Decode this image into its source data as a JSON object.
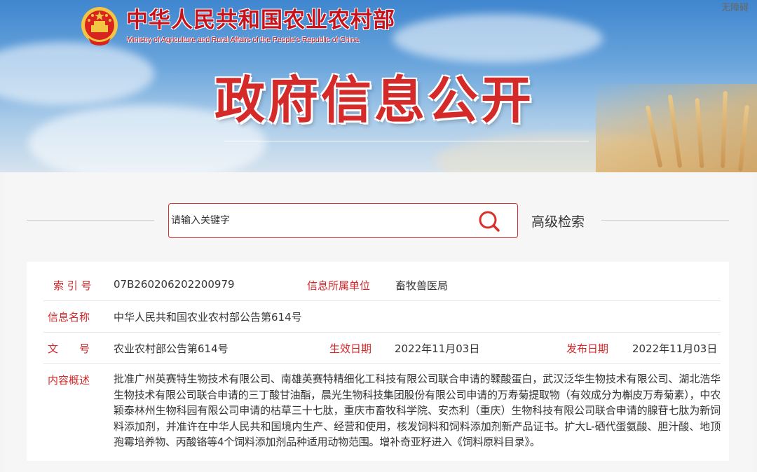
{
  "header": {
    "ministry_cn": "中华人民共和国农业农村部",
    "ministry_en": "Ministry of Agriculture and Rural Affairs of the People's Republic of China",
    "accessibility_link": "无障碍",
    "banner_title": "政府信息公开"
  },
  "search": {
    "placeholder": "请输入关键字",
    "advanced_label": "高级检索"
  },
  "info": {
    "index_label": "索 引 号",
    "index_value": "07B260206202200979",
    "dept_label": "信息所属单位",
    "dept_value": "畜牧兽医局",
    "name_label": "信息名称",
    "name_value": "中华人民共和国农业农村部公告第614号",
    "doc_label": "文　　号",
    "doc_value": "农业农村部公告第614号",
    "effective_label": "生效日期",
    "effective_value": "2022年11月03日",
    "publish_label": "发布日期",
    "publish_value": "2022年11月03日",
    "summary_label": "内容概述",
    "summary_value": "批准广州英赛特生物技术有限公司、南雄英赛特精细化工科技有限公司联合申请的鞣酸蛋白，武汉泛华生物技术有限公司、湖北浩华生物技术有限公司联合申请的三丁酸甘油酯，晨光生物科技集团股份有限公司申请的万寿菊提取物（有效成分为槲皮万寿菊素），中农颖泰林州生物科园有限公司申请的枯草三十七肽，重庆市畜牧科学院、安杰利（重庆）生物科技有限公司联合申请的腺苷七肽为新饲料添加剂，并准许在中华人民共和国境内生产、经营和使用，核发饲料和饲料添加剂新产品证书。扩大L-硒代蛋氨酸、胆汁酸、地顶孢霉培养物、丙酸铬等4个饲料添加剂品种适用动物范围。增补奇亚籽进入《饲料原料目录》。"
  },
  "colors": {
    "brand_red": "#c8121b",
    "label_red": "#d3282a",
    "search_border": "#d9302b"
  }
}
